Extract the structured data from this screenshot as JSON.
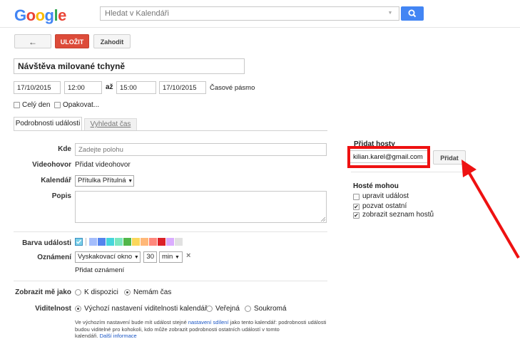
{
  "header": {
    "logo_letters": [
      {
        "ch": "G",
        "color": "#4285f4"
      },
      {
        "ch": "o",
        "color": "#ea4335"
      },
      {
        "ch": "o",
        "color": "#fbbc05"
      },
      {
        "ch": "g",
        "color": "#4285f4"
      },
      {
        "ch": "l",
        "color": "#34a853"
      },
      {
        "ch": "e",
        "color": "#ea4335"
      }
    ],
    "search_placeholder": "Hledat v Kalendáři",
    "search_button_color": "#4285f4"
  },
  "toolbar": {
    "back_label": "←",
    "save_label": "ULOŽIT",
    "discard_label": "Zahodit"
  },
  "event": {
    "title": "Návštěva milované tchyně",
    "start_date": "17/10/2015",
    "start_time": "12:00",
    "to_label": "až",
    "end_time": "15:00",
    "end_date": "17/10/2015",
    "timezone_link": "Časové pásmo",
    "all_day_label": "Celý den",
    "repeat_label": "Opakovat..."
  },
  "tabs": {
    "details": "Podrobnosti události",
    "find_time": "Vyhledat čas"
  },
  "details": {
    "where_label": "Kde",
    "where_placeholder": "Zadejte polohu",
    "video_label": "Videohovor",
    "video_link": "Přidat videohovor",
    "calendar_label": "Kalendář",
    "calendar_value": "Přítulka Přítulná",
    "description_label": "Popis",
    "color_label": "Barva události",
    "colors": [
      "#a4bdfc",
      "#5484ed",
      "#46d6db",
      "#7ae7bf",
      "#51b749",
      "#fbd75b",
      "#ffb878",
      "#ff887c",
      "#dc2127",
      "#dbadff",
      "#e1e1e1"
    ],
    "selected_color": "#7bd0e8",
    "notify_label": "Oznámení",
    "notify_type": "Vyskakovací okno",
    "notify_amount": "30",
    "notify_unit": "min",
    "notify_remove": "×",
    "add_notify_link": "Přidat oznámení",
    "show_as_label": "Zobrazit mě jako",
    "show_available": "K dispozici",
    "show_busy": "Nemám čas",
    "visibility_label": "Viditelnost",
    "vis_default": "Výchozí nastavení viditelnosti kalendáře",
    "vis_public": "Veřejná",
    "vis_private": "Soukromá",
    "info_line1_a": "Ve výchozím nastavení bude mít událost stejné ",
    "info_line1_link": "nastavení sdílení",
    "info_line1_b": " jako tento kalendář: podrobnosti události",
    "info_line2": "budou viditelné pro kohokoli, kdo může zobrazit podrobnosti ostatních událostí v tomto",
    "info_line3": "kalendáři.",
    "info_more_link": "Další informace"
  },
  "guests": {
    "heading": "Přidat hosty",
    "input_value": "kilian.karel@gmail.com",
    "add_button": "Přidat",
    "can_heading": "Hosté mohou",
    "perm_modify": "upravit událost",
    "perm_invite": "pozvat ostatní",
    "perm_see_list": "zobrazit seznam hostů",
    "annotation_color": "#ee1111"
  }
}
